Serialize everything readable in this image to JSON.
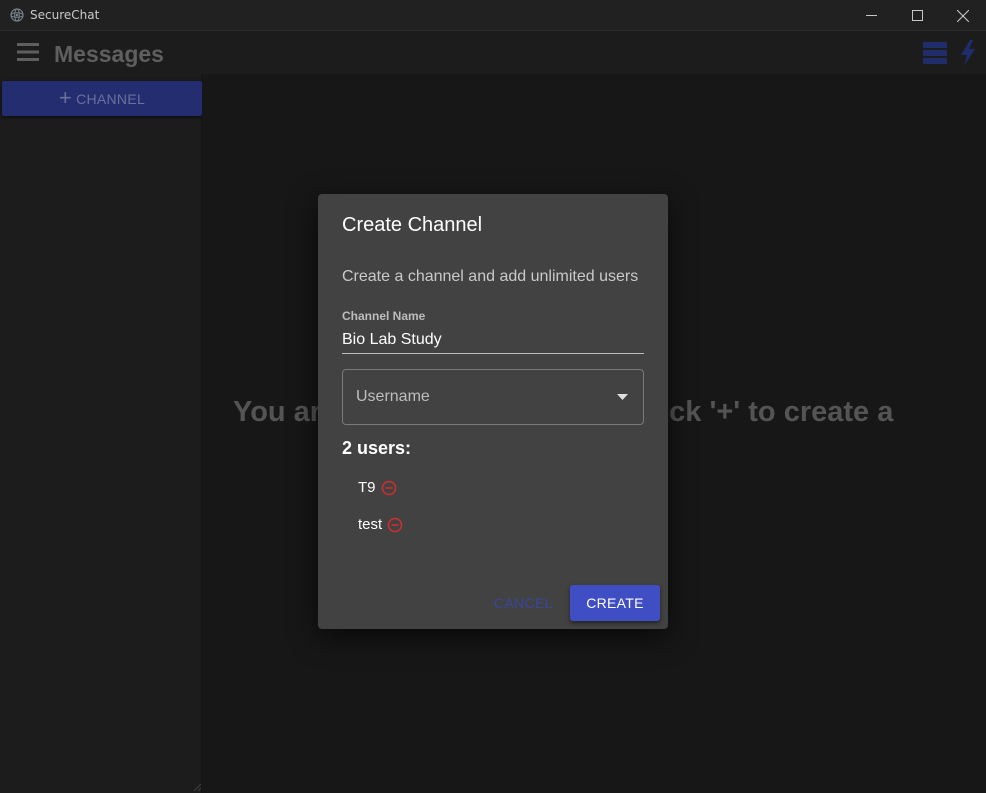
{
  "window": {
    "title": "SecureChat"
  },
  "appbar": {
    "title": "Messages"
  },
  "sidebar": {
    "add_channel_label": "CHANNEL"
  },
  "main": {
    "empty_message": "You are not in any channels. Click '+' to create a"
  },
  "dialog": {
    "title": "Create Channel",
    "description": "Create a channel and add unlimited users",
    "channel_name_label": "Channel Name",
    "channel_name_value": "Bio Lab Study",
    "username_placeholder": "Username",
    "users_count_label": "2 users:",
    "users": [
      {
        "name": "T9"
      },
      {
        "name": "test"
      }
    ],
    "cancel_label": "CANCEL",
    "create_label": "CREATE"
  },
  "colors": {
    "primary": "#3f4ec2",
    "remove": "#d32f2f",
    "dialog_bg": "#424242",
    "app_bg": "#1e1e1e"
  },
  "icons": [
    "app-logo-icon",
    "minimize-icon",
    "maximize-icon",
    "close-icon",
    "menu-icon",
    "server-icon",
    "bolt-icon",
    "plus-icon",
    "caret-down-icon",
    "remove-user-icon"
  ]
}
